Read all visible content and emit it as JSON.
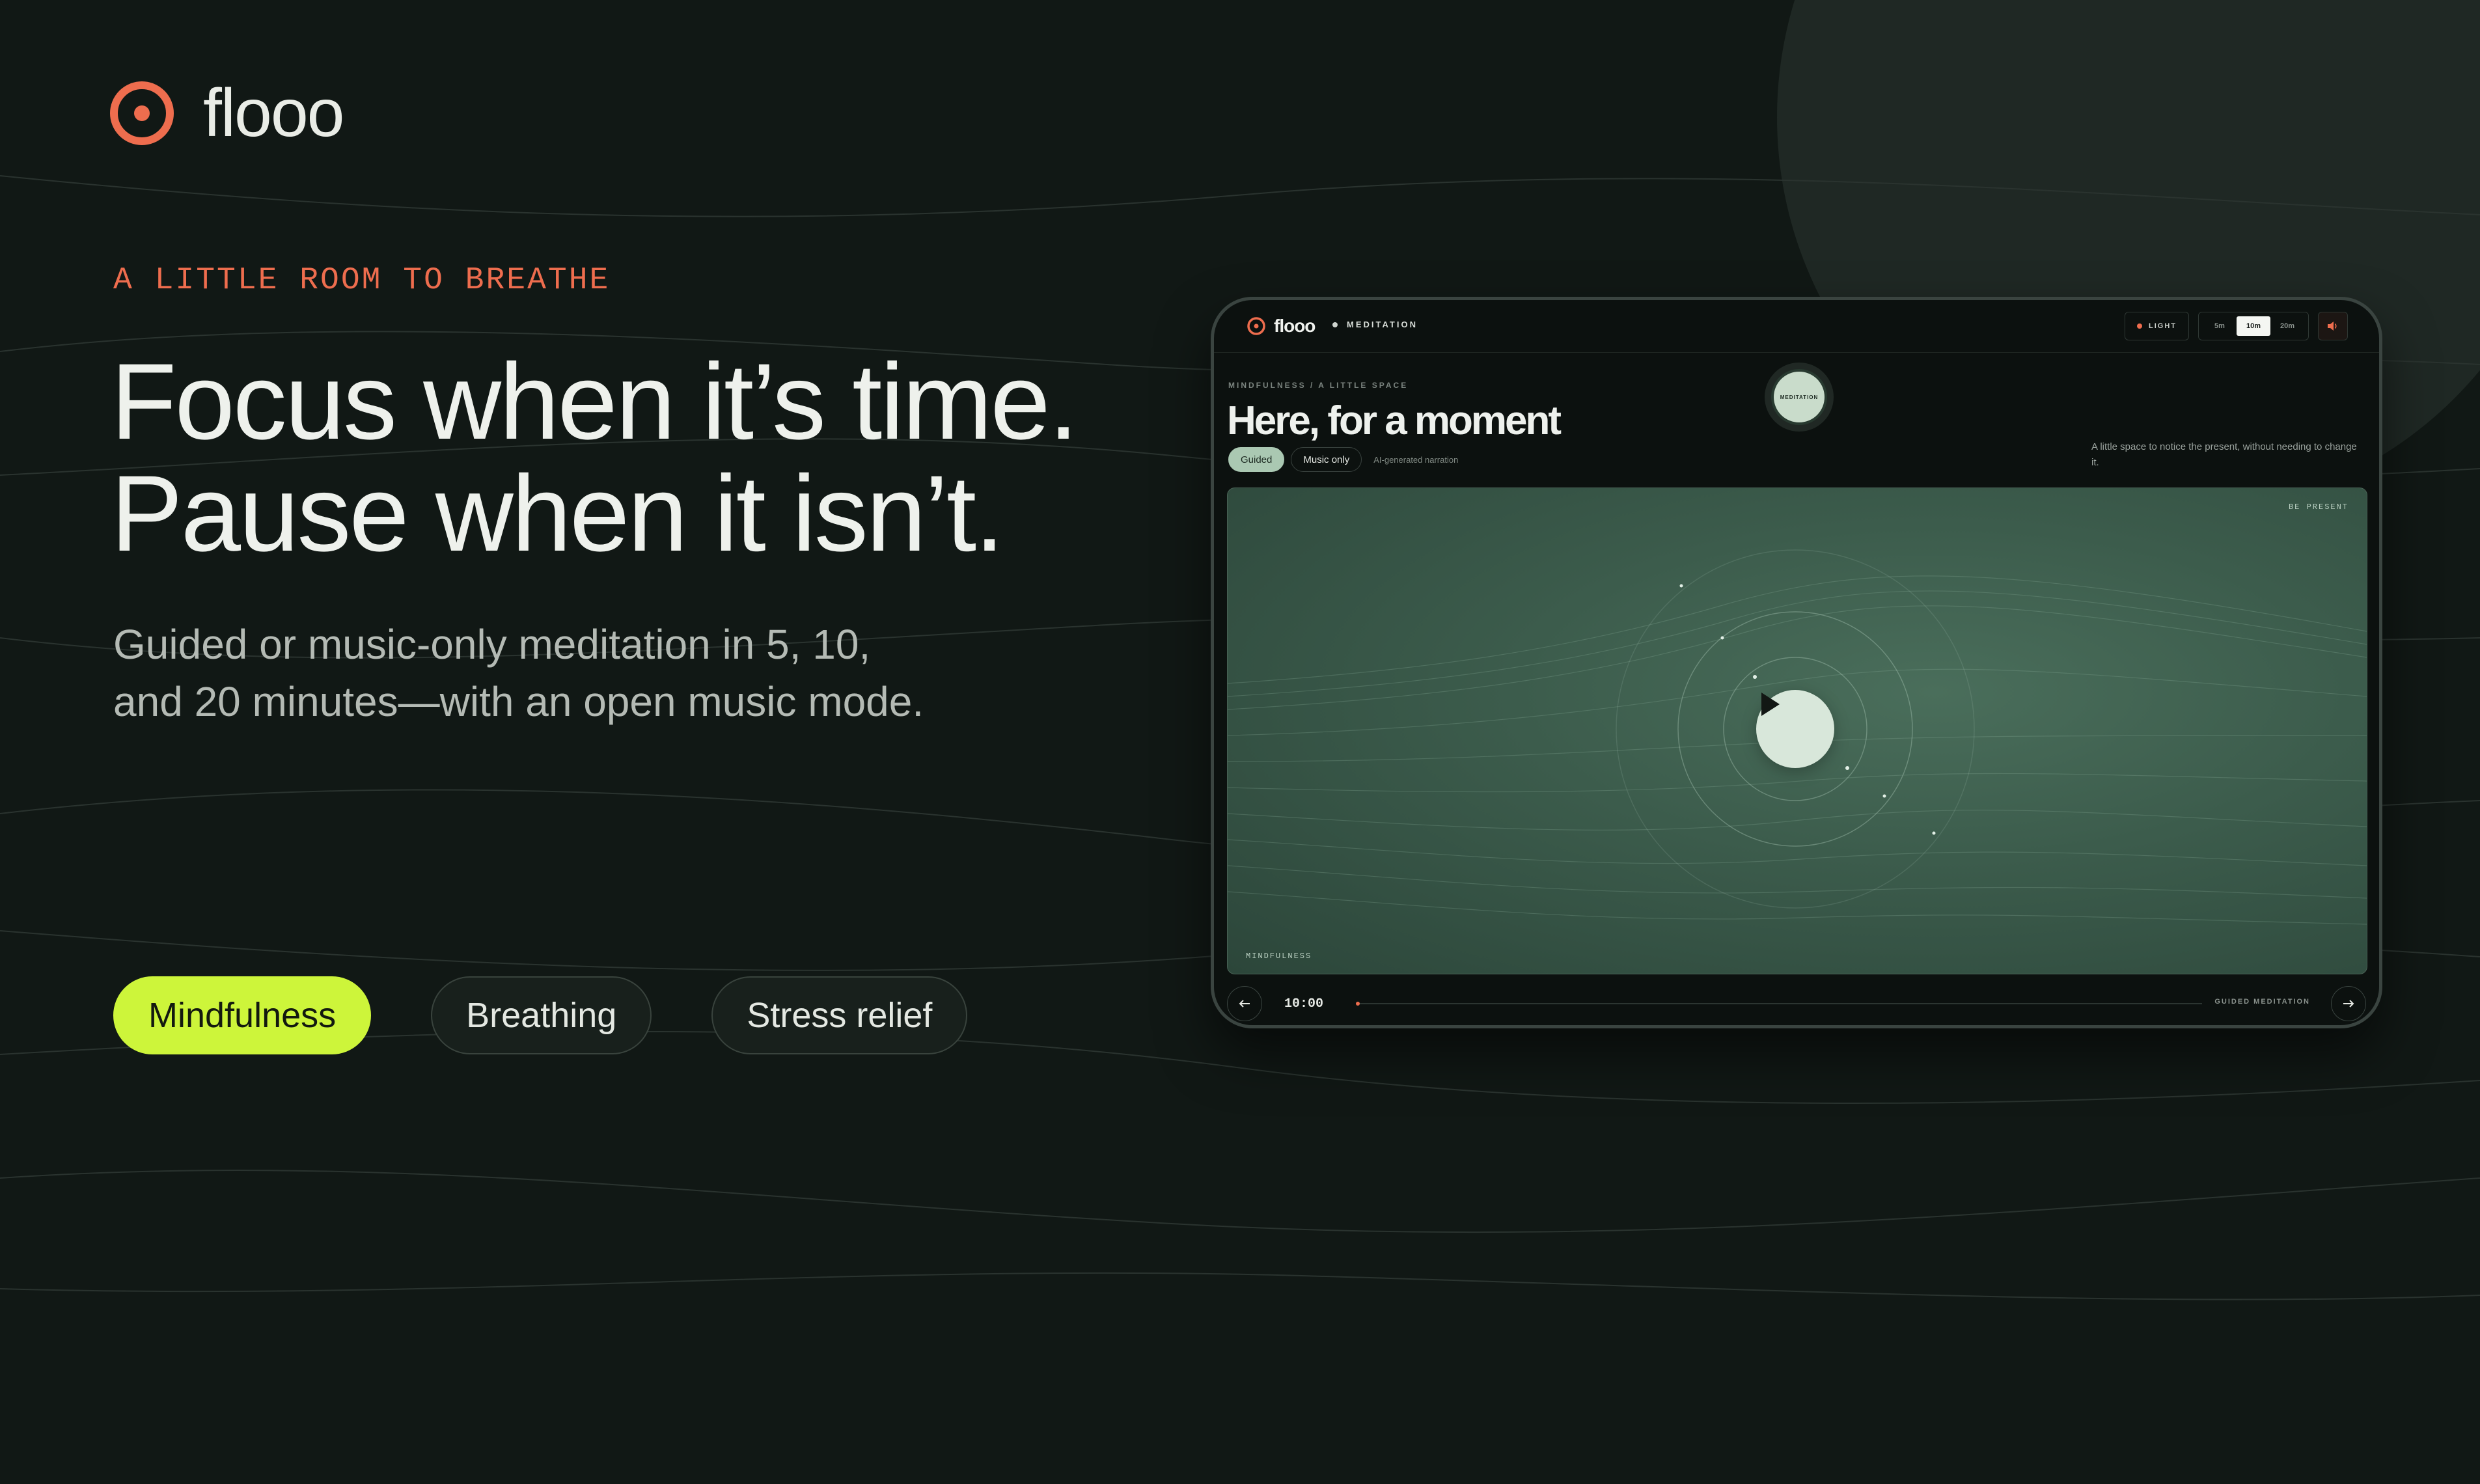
{
  "brand": {
    "name": "flooo",
    "accent": "#ee6d4e",
    "lime": "#cdf53a"
  },
  "hero": {
    "eyebrow": "A LITTLE ROOM TO BREATHE",
    "headline_line1": "Focus when it’s time.",
    "headline_line2": "Pause when it isn’t.",
    "subtitle_line1": "Guided or music-only meditation in 5, 10,",
    "subtitle_line2": "and 20 minutes—with an open music mode."
  },
  "chips": [
    {
      "label": "Mindfulness",
      "active": true
    },
    {
      "label": "Breathing",
      "active": false
    },
    {
      "label": "Stress relief",
      "active": false
    }
  ],
  "app": {
    "brand": "flooo",
    "section": "MEDITATION",
    "theme_label": "LIGHT",
    "durations": [
      {
        "label": "5m",
        "active": false
      },
      {
        "label": "10m",
        "active": true
      },
      {
        "label": "20m",
        "active": false
      }
    ],
    "breadcrumb": "MINDFULNESS / A LITTLE SPACE",
    "title": "Here, for a moment",
    "modes": [
      {
        "label": "Guided",
        "active": true
      },
      {
        "label": "Music only",
        "active": false
      }
    ],
    "mode_note": "AI-generated narration",
    "description": "A little space to notice the present, without needing to change it.",
    "badge": "MEDITATION",
    "player_tag": "BE PRESENT",
    "player_label": "MINDFULNESS",
    "timer": "10:00",
    "progress": 0,
    "track_label": "GUIDED MEDITATION"
  }
}
